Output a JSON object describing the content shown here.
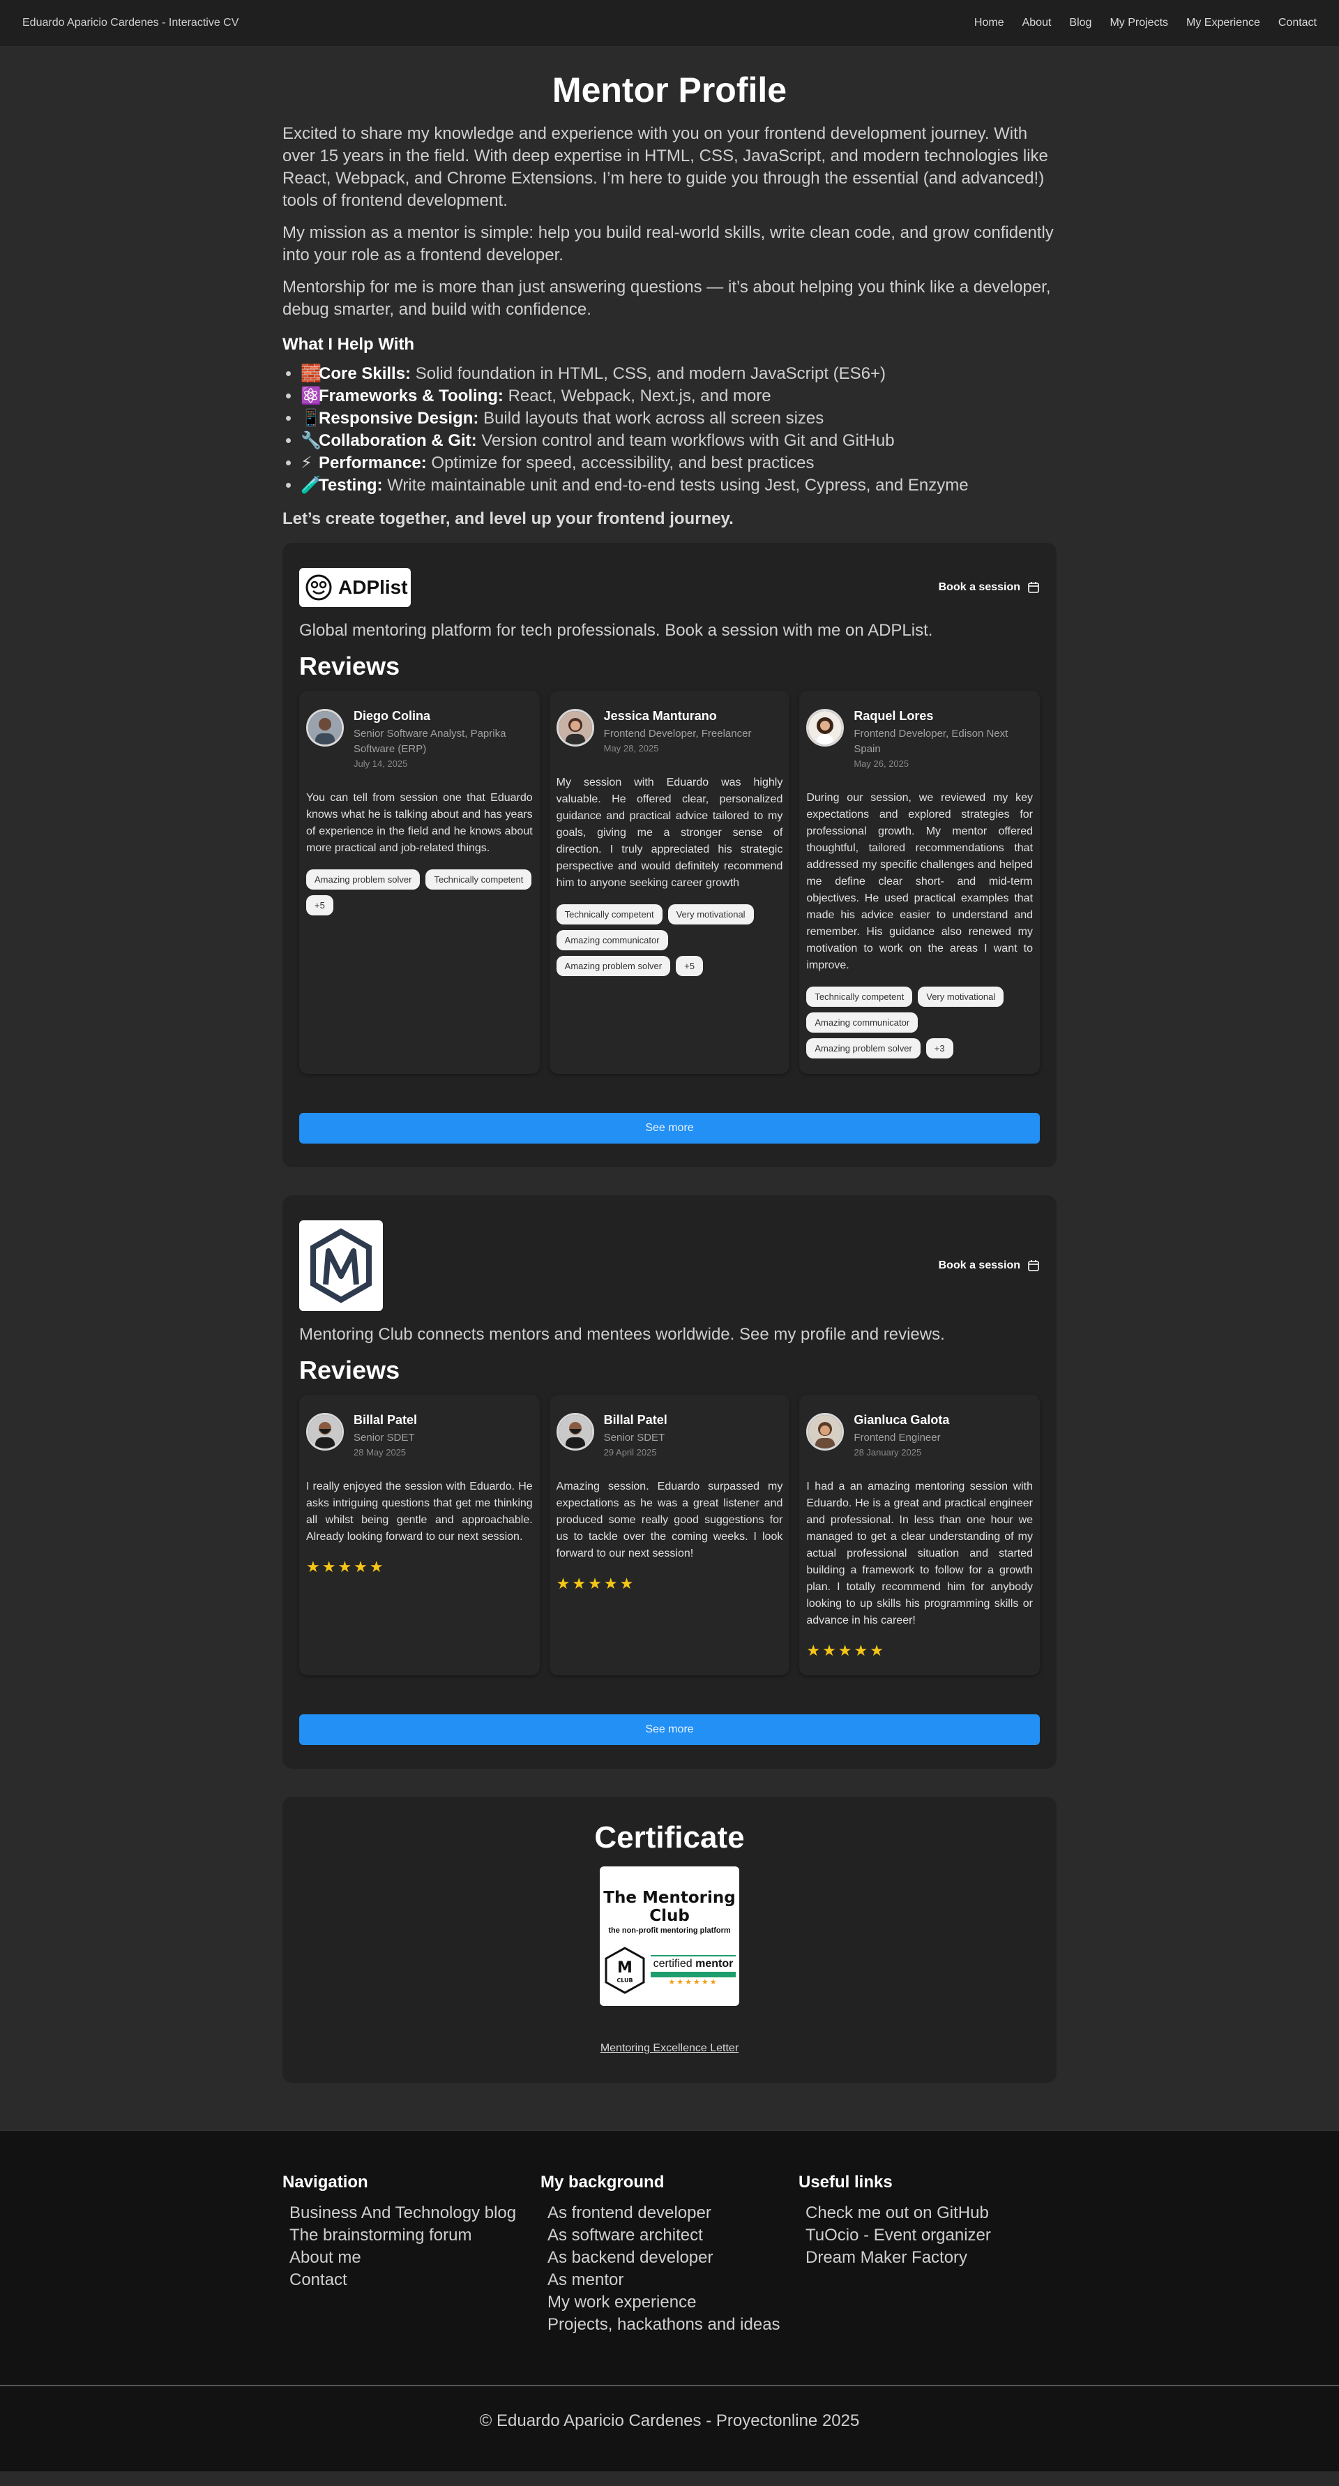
{
  "header": {
    "title": "Eduardo Aparicio Cardenes - Interactive CV",
    "nav": [
      "Home",
      "About",
      "Blog",
      "My Projects",
      "My Experience",
      "Contact"
    ]
  },
  "main": {
    "title": "Mentor Profile",
    "intro": [
      "Excited to share my knowledge and experience with you on your frontend development journey. With over 15 years in the field. With deep expertise in HTML, CSS, JavaScript, and modern technologies like React, Webpack, and Chrome Extensions. I’m here to guide you through the essential (and advanced!) tools of frontend development.",
      "My mission as a mentor is simple: help you build real-world skills, write clean code, and grow confidently into your role as a frontend developer.",
      "Mentorship for me is more than just answering questions — it’s about helping you think like a developer, debug smarter, and build with confidence."
    ],
    "help_title": "What I Help With",
    "help_items": [
      {
        "icon": "🧱",
        "label": "Core Skills:",
        "text": " Solid foundation in HTML, CSS, and modern JavaScript (ES6+)"
      },
      {
        "icon": "⚛️",
        "label": "Frameworks & Tooling:",
        "text": " React, Webpack, Next.js, and more"
      },
      {
        "icon": "📱",
        "label": "Responsive Design:",
        "text": " Build layouts that work across all screen sizes"
      },
      {
        "icon": "🔧",
        "label": "Collaboration & Git:",
        "text": " Version control and team workflows with Git and GitHub"
      },
      {
        "icon": "⚡",
        "label": "Performance:",
        "text": " Optimize for speed, accessibility, and best practices"
      },
      {
        "icon": "🧪",
        "label": "Testing:",
        "text": " Write maintainable unit and end-to-end tests using Jest, Cypress, and Enzyme"
      }
    ],
    "closing": "Let’s create together, and level up your frontend journey."
  },
  "adplist": {
    "logo_text": "ADPlist",
    "book_label": "Book a session",
    "description": "Global mentoring platform for tech professionals. Book a session with me on ADPList.",
    "reviews_title": "Reviews",
    "reviews": [
      {
        "name": "Diego Colina",
        "role": "Senior Software Analyst, Paprika Software (ERP)",
        "date": "July 14, 2025",
        "text": "You can tell from session one that Eduardo knows what he is talking about and has years of experience in the field and he knows about more practical and job-related things.",
        "tags": [
          "Amazing problem solver",
          "Technically competent",
          "+5"
        ]
      },
      {
        "name": "Jessica Manturano",
        "role": "Frontend Developer, Freelancer",
        "date": "May 28, 2025",
        "text": "My session with Eduardo was highly valuable. He offered clear, personalized guidance and practical advice tailored to my goals, giving me a stronger sense of direction. I truly appreciated his strategic perspective and would definitely recommend him to anyone seeking career growth",
        "tags": [
          "Technically competent",
          "Very motivational",
          "Amazing communicator",
          "Amazing problem solver",
          "+5"
        ]
      },
      {
        "name": "Raquel Lores",
        "role": "Frontend Developer, Edison Next Spain",
        "date": "May 26, 2025",
        "text": "During our session, we reviewed my key expectations and explored strategies for professional growth. My mentor offered thoughtful, tailored recommendations that addressed my specific challenges and helped me define clear short- and mid-term objectives. He used practical examples that made his advice easier to understand and remember. His guidance also renewed my motivation to work on the areas I want to improve.",
        "tags": [
          "Technically competent",
          "Very motivational",
          "Amazing communicator",
          "Amazing problem solver",
          "+3"
        ]
      }
    ],
    "see_more": "See more"
  },
  "mentoring_club": {
    "book_label": "Book a session",
    "description": "Mentoring Club connects mentors and mentees worldwide. See my profile and reviews.",
    "reviews_title": "Reviews",
    "reviews": [
      {
        "name": "Billal Patel",
        "role": "Senior SDET",
        "date": "28 May 2025",
        "text": "I really enjoyed the session with Eduardo. He asks intriguing questions that get me thinking all whilst being gentle and approachable. Already looking forward to our next session.",
        "stars": "★★★★★"
      },
      {
        "name": "Billal Patel",
        "role": "Senior SDET",
        "date": "29 April 2025",
        "text": "Amazing session. Eduardo surpassed my expectations as he was a great listener and produced some really good suggestions for us to tackle over the coming weeks. I look forward to our next session!",
        "stars": "★★★★★"
      },
      {
        "name": "Gianluca Galota",
        "role": "Frontend Engineer",
        "date": "28 January 2025",
        "text": "I had a an amazing mentoring session with Eduardo. He is a great and practical engineer and professional. In less than one hour we managed to get a clear understanding of my actual professional situation and started building a framework to follow for a growth plan. I totally recommend him for anybody looking to up skills his programming skills or advance in his career!",
        "stars": "★★★★★"
      }
    ],
    "see_more": "See more"
  },
  "certificate": {
    "title": "Certificate",
    "brand": "The Mentoring Club",
    "subtitle": "the non-profit mentoring platform",
    "badge_letter": "M",
    "badge_word": "CLUB",
    "badge_text_a": "certified",
    "badge_text_b": "mentor",
    "badge_stars": "★★★★★★",
    "link": "Mentoring Excellence Letter"
  },
  "footer": {
    "columns": [
      {
        "title": "Navigation",
        "items": [
          "Business And Technology blog",
          "The brainstorming forum",
          "About me",
          "Contact"
        ]
      },
      {
        "title": "My background",
        "items": [
          "As frontend developer",
          "As software architect",
          "As backend developer",
          "As mentor",
          "My work experience",
          "Projects, hackathons and ideas"
        ]
      },
      {
        "title": "Useful links",
        "items": [
          "Check me out on GitHub",
          "TuOcio - Event organizer",
          "Dream Maker Factory"
        ]
      }
    ],
    "copyright": "© Eduardo Aparicio Cardenes - Proyectonline 2025"
  }
}
